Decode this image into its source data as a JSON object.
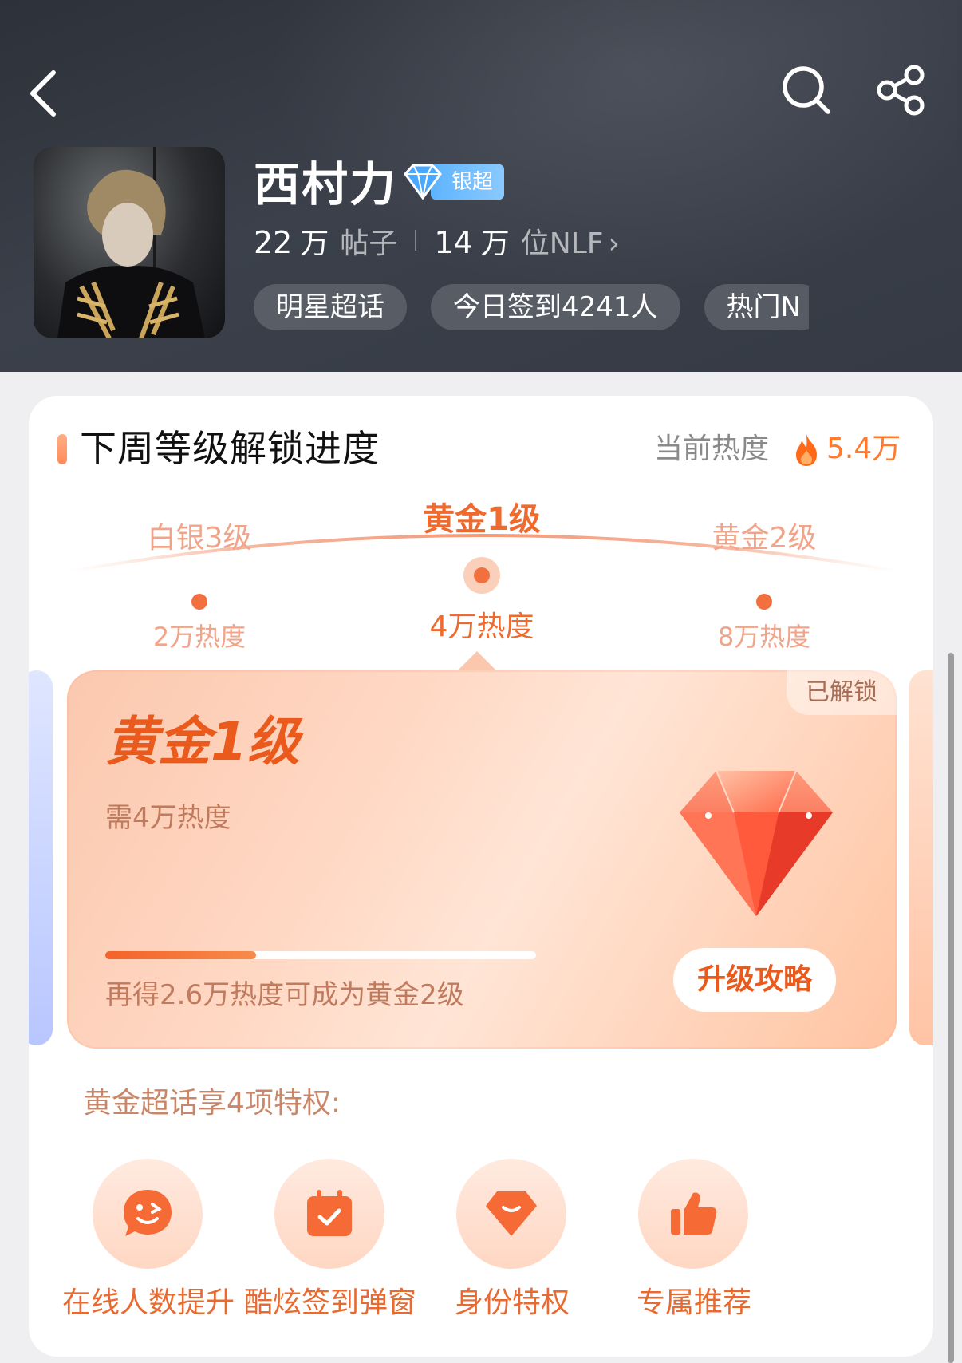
{
  "header": {
    "topic_name": "西村力",
    "badge_label": "银超",
    "posts_count": "22",
    "posts_unit": "万",
    "posts_label": "帖子",
    "followers_count": "14",
    "followers_unit": "万",
    "followers_label": "位NLF",
    "tags": [
      "明星超话",
      "今日签到4241人",
      "热门N"
    ],
    "icons": {
      "back": "back-arrow-icon",
      "search": "search-icon",
      "share": "share-icon"
    }
  },
  "card": {
    "title": "下周等级解锁进度",
    "heat_label": "当前热度",
    "heat_value": "5.4万",
    "levels": [
      {
        "name": "白银3级",
        "heat": "2万热度"
      },
      {
        "name": "黄金1级",
        "heat": "4万热度"
      },
      {
        "name": "黄金2级",
        "heat": "8万热度"
      }
    ],
    "level_card": {
      "title": "黄金1级",
      "status": "已解锁",
      "need": "需4万热度",
      "progress": 0.35,
      "hint": "再得2.6万热度可成为黄金2级",
      "button": "升级攻略"
    },
    "perks_title": "黄金超话享4项特权:",
    "perks": [
      {
        "label": "在线人数提升",
        "icon": "smile-chat-icon"
      },
      {
        "label": "酷炫签到弹窗",
        "icon": "calendar-check-icon"
      },
      {
        "label": "身份特权",
        "icon": "gem-icon"
      },
      {
        "label": "专属推荐",
        "icon": "thumbs-up-icon"
      }
    ]
  },
  "colors": {
    "accent": "#ee6a2e",
    "header_bg": "#353a44",
    "badge": "#5eb4ff"
  }
}
